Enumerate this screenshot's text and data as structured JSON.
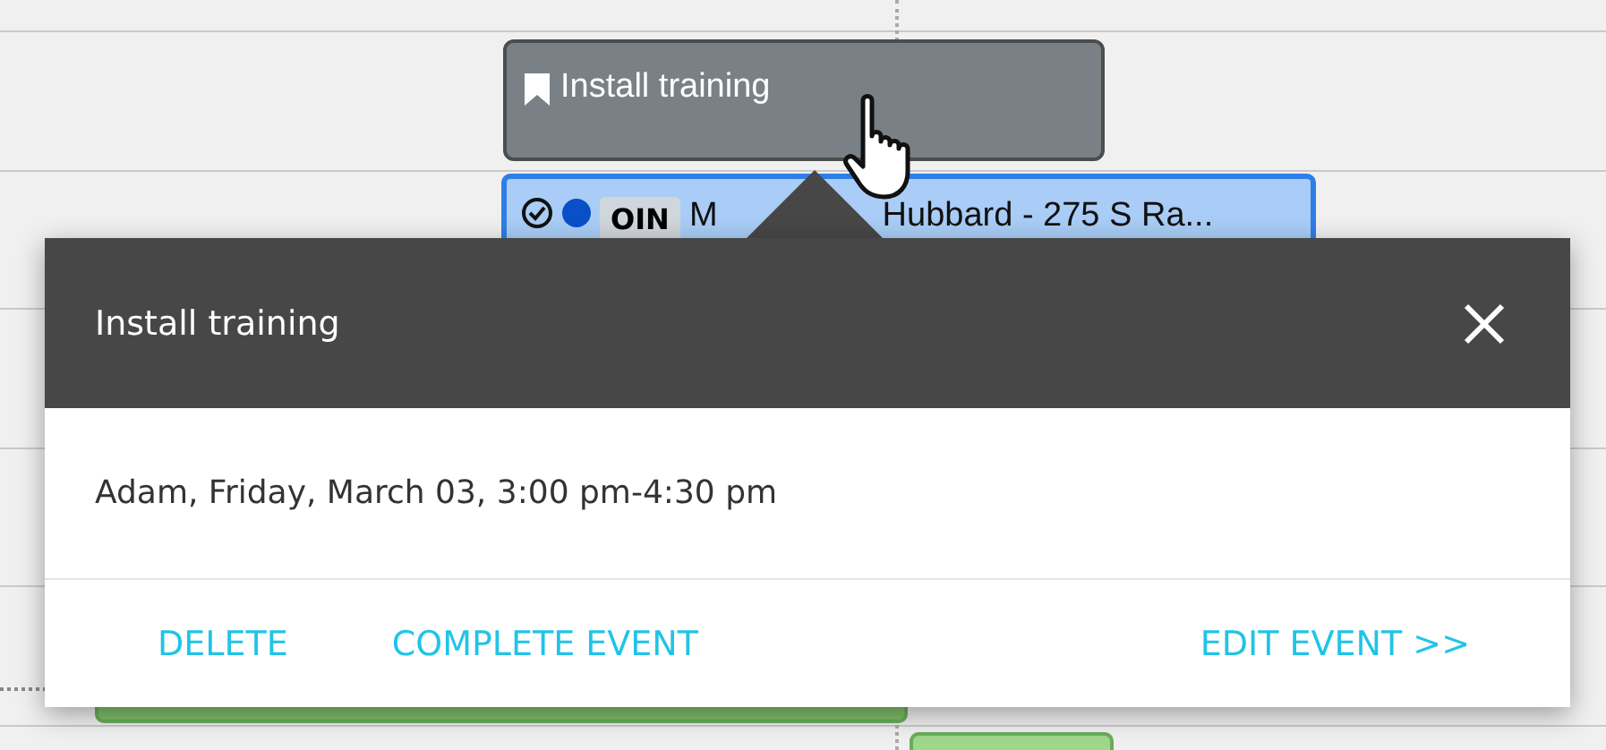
{
  "calendar": {
    "events": [
      {
        "kind": "task",
        "title": "Install training"
      },
      {
        "kind": "appointment",
        "color": "#0a4fc8",
        "badge": "OIN",
        "title_start": "M",
        "title_end": "Hubbard - 275 S Ra..."
      }
    ]
  },
  "popup": {
    "title": "Install training",
    "details": "Adam, Friday, March 03, 3:00 pm-4:30 pm",
    "actions": [
      {
        "label": "DELETE"
      },
      {
        "label": "COMPLETE EVENT"
      },
      {
        "label": "EDIT EVENT >>"
      }
    ]
  }
}
